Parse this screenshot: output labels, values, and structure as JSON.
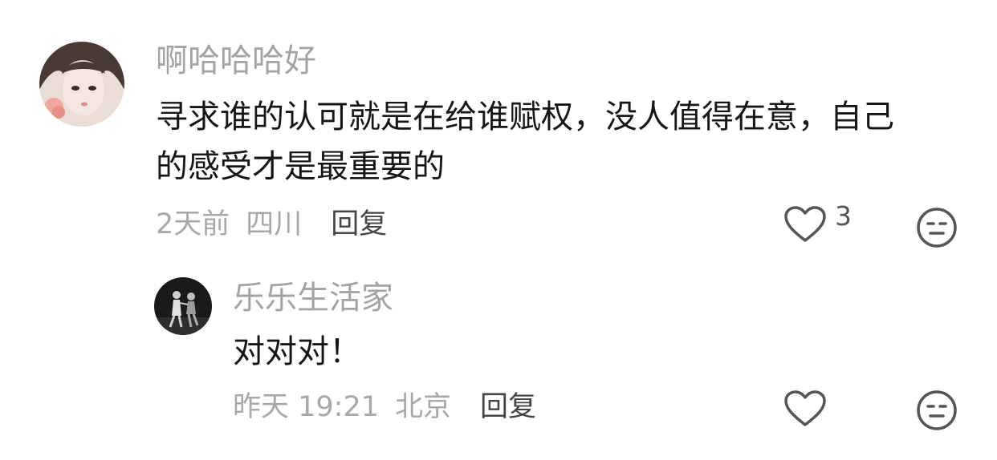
{
  "comment": {
    "avatar_icon": "user-avatar-illustrated-girl",
    "username": "啊哈哈哈好",
    "text_line1": "寻求谁的认可就是在给谁赋权，没人值得在意，自己",
    "text_line2": "的感受才是最重要的",
    "time": "2天前",
    "location": "四川",
    "reply_label": "回复",
    "like_icon": "heart-outline-icon",
    "like_count": "3",
    "dislike_icon": "meh-face-icon"
  },
  "reply": {
    "avatar_icon": "user-avatar-dancers-photo",
    "username": "乐乐生活家",
    "text": "对对对！",
    "time": "昨天 19:21",
    "location": "北京",
    "reply_label": "回复",
    "like_icon": "heart-outline-icon",
    "dislike_icon": "meh-face-icon"
  },
  "colors": {
    "username": "#a3a3a3",
    "content": "#161616",
    "meta": "#a8a8a8",
    "reply_link": "#444444",
    "icon": "#555555"
  }
}
